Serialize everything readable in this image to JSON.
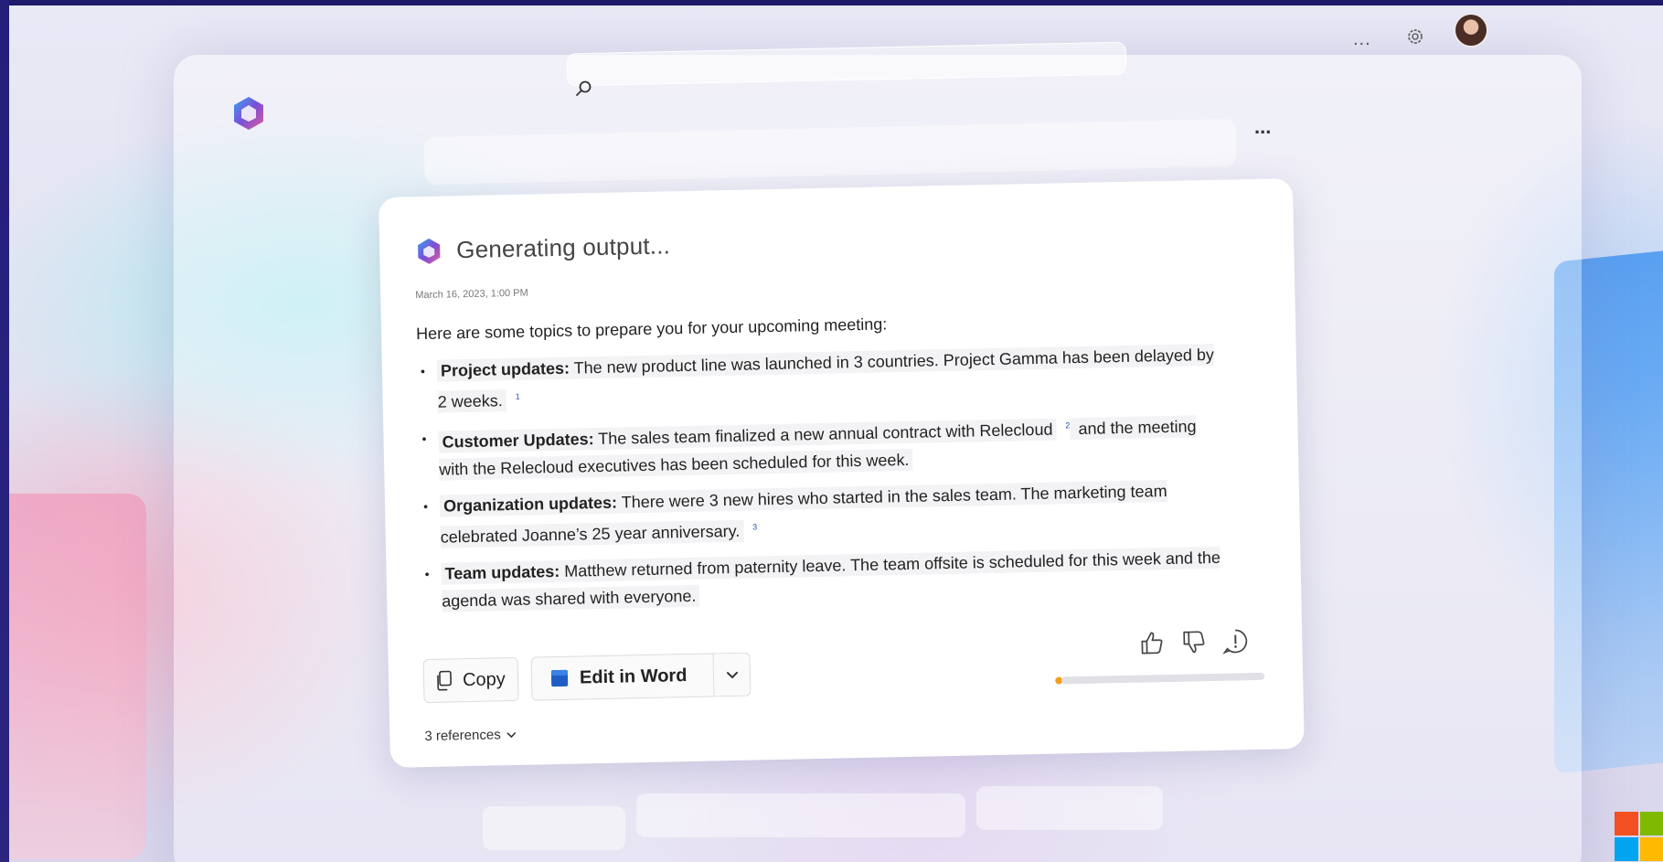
{
  "header": {
    "more_label": "...",
    "search_placeholder": ""
  },
  "prompt": {
    "more_label": "..."
  },
  "card": {
    "status_title": "Generating output...",
    "timestamp": "March 16, 2023, 1:00 PM",
    "intro": "Here are some topics to prepare you for your upcoming meeting:",
    "bullets": [
      {
        "label": "Project updates:",
        "text": " The new product line was launched in 3 countries. Project Gamma has been delayed by 2 weeks.",
        "cite": "1"
      },
      {
        "label": "Customer Updates:",
        "text": " The sales team finalized a new annual contract with Relecloud",
        "cite": "2",
        "text_after": " and the meeting with the Relecloud executives has been scheduled for this week."
      },
      {
        "label": "Organization updates:",
        "text": " There were 3 new hires who started in the sales team. The marketing team celebrated Joanne’s 25 year anniversary.",
        "cite": "3"
      },
      {
        "label": "Team updates:",
        "text": " Matthew returned from paternity leave. The team offsite is scheduled for this week and the agenda was shared with everyone."
      }
    ],
    "copy_label": "Copy",
    "edit_in_word_label": "Edit in Word",
    "references_label": "3 references",
    "progress": 0.05
  },
  "icons": {
    "app_logo": "copilot-logo-icon",
    "search": "search-icon",
    "settings": "gear-icon",
    "thumbs_up": "thumbs-up-icon",
    "thumbs_down": "thumbs-down-icon",
    "feedback": "feedback-icon",
    "copy": "copy-icon",
    "word": "word-icon",
    "chevron": "chevron-down-icon",
    "brand_corner": "microsoft-logo-icon"
  },
  "colors": {
    "progress_accent": "#f0a21c",
    "citation": "#2a4fb8",
    "word_blue": "#1f5cc4"
  }
}
